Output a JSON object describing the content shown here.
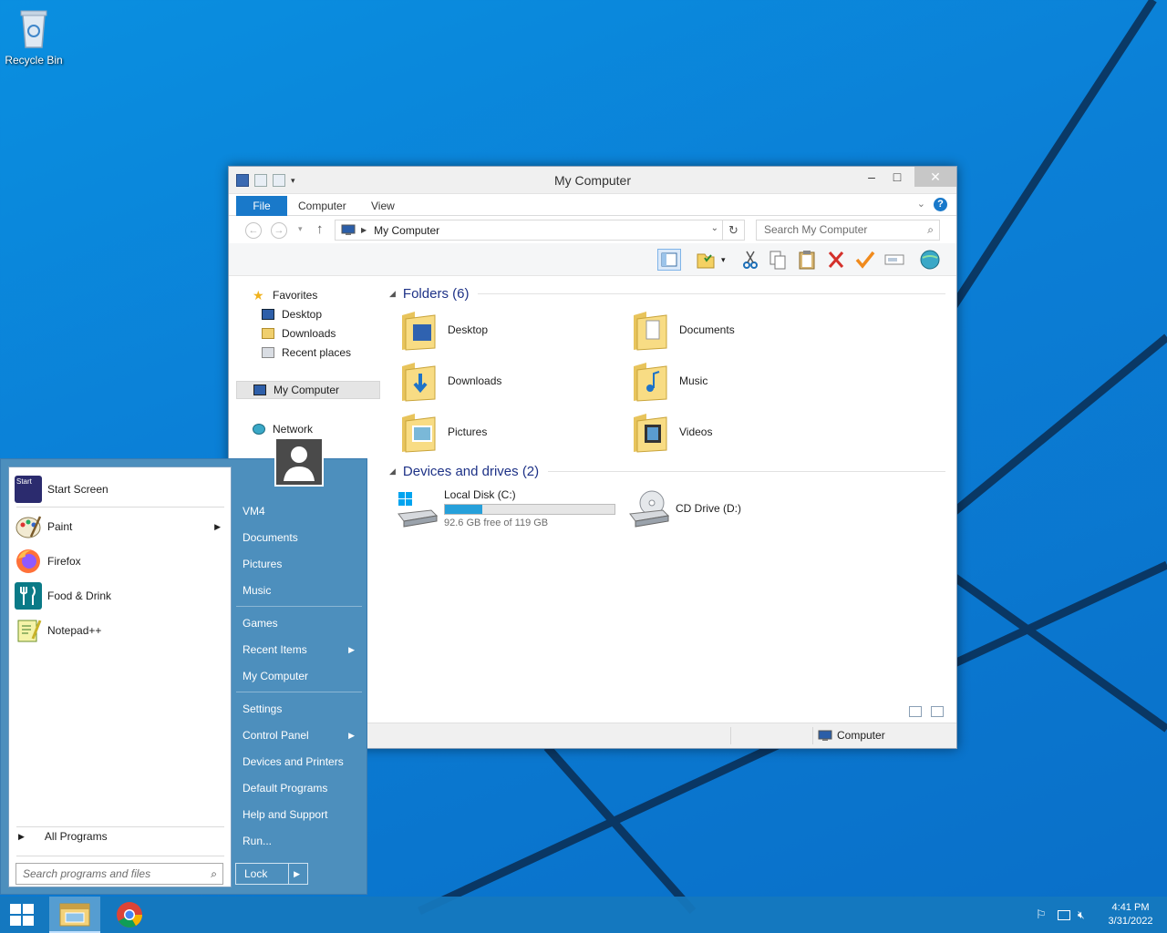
{
  "desktop": {
    "recycle_bin": "Recycle Bin"
  },
  "explorer": {
    "title": "My Computer",
    "ribbon_tabs": [
      "File",
      "Computer",
      "View"
    ],
    "address": "My Computer",
    "search_placeholder": "Search My Computer",
    "nav": {
      "favorites": "Favorites",
      "desktop": "Desktop",
      "downloads": "Downloads",
      "recent": "Recent places",
      "my_computer": "My Computer",
      "network": "Network"
    },
    "folders_header": "Folders (6)",
    "folders": [
      "Desktop",
      "Documents",
      "Downloads",
      "Music",
      "Pictures",
      "Videos"
    ],
    "devices_header": "Devices and drives (2)",
    "drives": {
      "local_name": "Local Disk (C:)",
      "local_free": "92.6 GB free of 119 GB",
      "local_used_fraction": 0.22,
      "cd_name": "CD Drive (D:)"
    },
    "status_location": "Computer"
  },
  "start_menu": {
    "pinned": [
      "Start Screen",
      "Paint",
      "Firefox",
      "Food & Drink",
      "Notepad++"
    ],
    "all_programs": "All Programs",
    "search_placeholder": "Search programs and files",
    "right_links": [
      "VM4",
      "Documents",
      "Pictures",
      "Music",
      "Games",
      "Recent Items",
      "My Computer",
      "Settings",
      "Control Panel",
      "Devices and Printers",
      "Default Programs",
      "Help and Support",
      "Run..."
    ],
    "lock": "Lock",
    "start_tile_text": "Start"
  },
  "taskbar": {
    "time": "4:41 PM",
    "date": "3/31/2022"
  },
  "colors": {
    "accent": "#1979ca",
    "start_menu_bg": "#4d8fbd",
    "progress_fill": "#26a0da"
  }
}
